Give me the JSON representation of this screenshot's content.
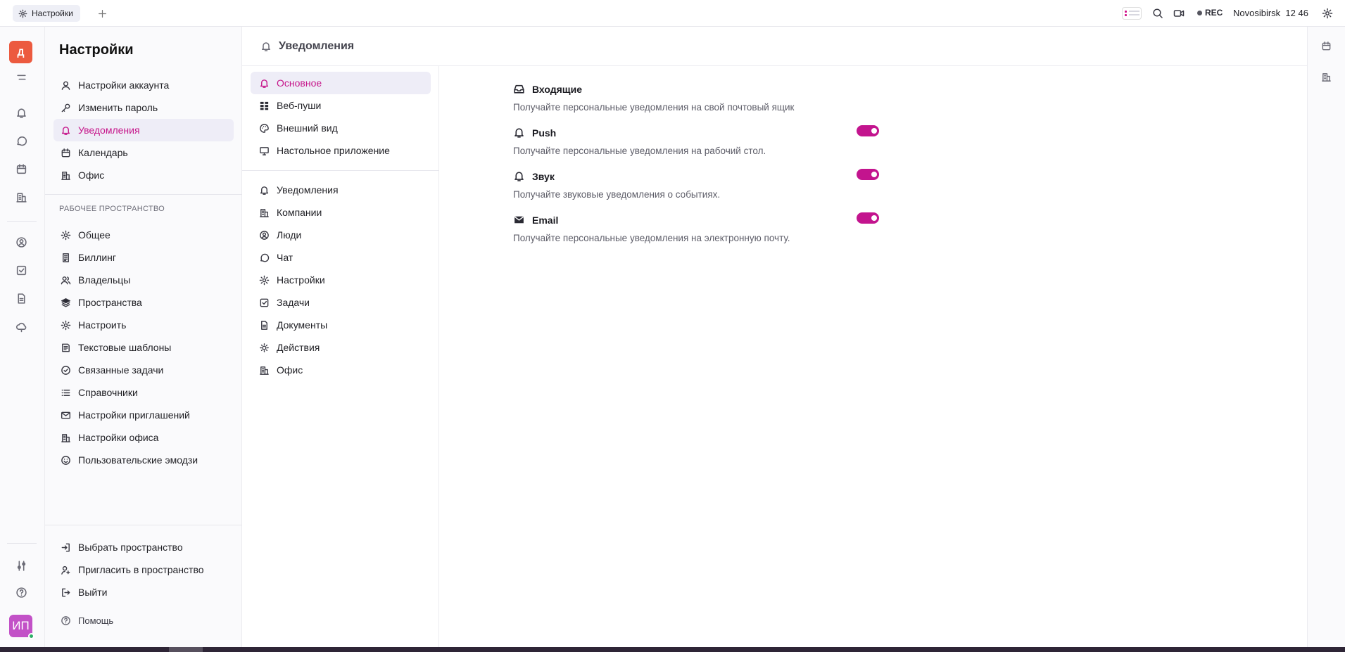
{
  "topbar": {
    "tab_label": "Настройки",
    "rec_label": "REC",
    "location": "Novosibirsk",
    "time": "12 46"
  },
  "rail": {
    "workspace_initial": "Д",
    "user_initials": "ИП",
    "icons": [
      "menu-icon",
      "bell-icon",
      "chat-icon",
      "calendar-icon",
      "office-icon",
      "user-icon",
      "tasks-icon",
      "document-icon",
      "cloud-icon",
      "sliders-icon",
      "help-icon"
    ]
  },
  "settings_nav": {
    "title": "Настройки",
    "account_items": [
      {
        "label": "Настройки аккаунта",
        "icon": "user-icon"
      },
      {
        "label": "Изменить пароль",
        "icon": "key-icon"
      },
      {
        "label": "Уведомления",
        "icon": "bell-icon",
        "active": true
      },
      {
        "label": "Календарь",
        "icon": "calendar-icon"
      },
      {
        "label": "Офис",
        "icon": "office-icon"
      }
    ],
    "workspace_section": "РАБОЧЕЕ ПРОСТРАНСТВО",
    "workspace_items": [
      {
        "label": "Общее",
        "icon": "gear-icon"
      },
      {
        "label": "Биллинг",
        "icon": "receipt-icon"
      },
      {
        "label": "Владельцы",
        "icon": "users-icon"
      },
      {
        "label": "Пространства",
        "icon": "layers-icon"
      },
      {
        "label": "Настроить",
        "icon": "gear-icon"
      },
      {
        "label": "Текстовые шаблоны",
        "icon": "template-icon"
      },
      {
        "label": "Связанные задачи",
        "icon": "check-circle-icon"
      },
      {
        "label": "Справочники",
        "icon": "list-icon"
      },
      {
        "label": "Настройки приглашений",
        "icon": "mail-icon"
      },
      {
        "label": "Настройки офиса",
        "icon": "office-icon"
      },
      {
        "label": "Пользовательские эмодзи",
        "icon": "smile-icon"
      }
    ],
    "footer_items": [
      {
        "label": "Выбрать пространство",
        "icon": "enter-icon"
      },
      {
        "label": "Пригласить в пространство",
        "icon": "add-user-icon"
      },
      {
        "label": "Выйти",
        "icon": "exit-icon"
      }
    ],
    "help_label": "Помощь"
  },
  "main": {
    "title": "Уведомления",
    "sub_group1": [
      {
        "label": "Основное",
        "icon": "bell-icon",
        "active": true
      },
      {
        "label": "Веб-пуши",
        "icon": "grid-icon"
      },
      {
        "label": "Внешний вид",
        "icon": "palette-icon"
      },
      {
        "label": "Настольное приложение",
        "icon": "monitor-icon"
      }
    ],
    "sub_group2": [
      {
        "label": "Уведомления",
        "icon": "bell-icon"
      },
      {
        "label": "Компании",
        "icon": "office-icon"
      },
      {
        "label": "Люди",
        "icon": "person-circle-icon"
      },
      {
        "label": "Чат",
        "icon": "chat-icon"
      },
      {
        "label": "Настройки",
        "icon": "gear-icon"
      },
      {
        "label": "Задачи",
        "icon": "tasks-icon"
      },
      {
        "label": "Документы",
        "icon": "document-icon"
      },
      {
        "label": "Действия",
        "icon": "sun-icon"
      },
      {
        "label": "Офис",
        "icon": "office-icon"
      }
    ],
    "notifications": [
      {
        "title": "Входящие",
        "desc": "Получайте персональные уведомления на свой почтовый ящик",
        "icon": "inbox-icon",
        "toggle": null
      },
      {
        "title": "Push",
        "desc": "Получайте персональные уведомления на рабочий стол.",
        "icon": "bell-icon",
        "toggle": true
      },
      {
        "title": "Звук",
        "desc": "Получайте звуковые уведомления о событиях.",
        "icon": "bell-icon",
        "toggle": true
      },
      {
        "title": "Email",
        "desc": "Получайте персональные уведомления на электронную почту.",
        "icon": "envelope-icon",
        "toggle": true
      }
    ]
  },
  "accent_color": "#c3148e"
}
